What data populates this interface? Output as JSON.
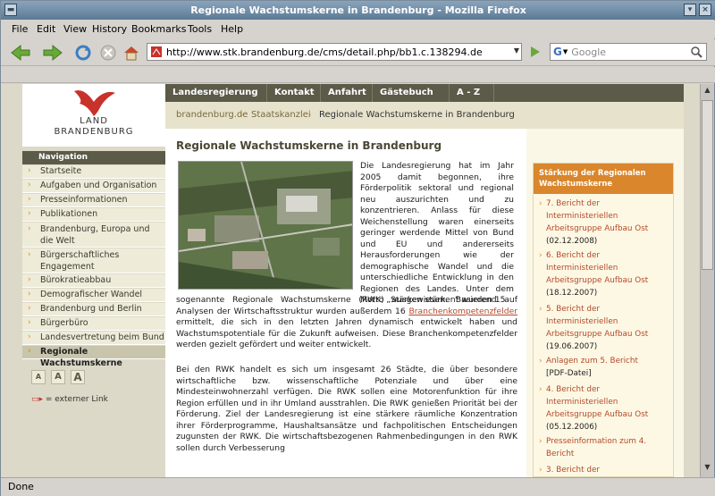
{
  "window": {
    "title": "Regionale Wachstumskerne in Brandenburg - Mozilla Firefox"
  },
  "menu": [
    "File",
    "Edit",
    "View",
    "History",
    "Bookmarks",
    "Tools",
    "Help"
  ],
  "toolbar": {
    "url": "http://www.stk.brandenburg.de/cms/detail.php/bb1.c.138294.de",
    "search_placeholder": "Google"
  },
  "status": "Done",
  "site": {
    "logo": {
      "line1": "LAND",
      "line2": "BRANDENBURG"
    },
    "topnav": [
      "Landesregierung",
      "Kontakt",
      "Anfahrt",
      "Gästebuch",
      "A - Z"
    ],
    "breadcrumb": [
      "brandenburg.de",
      "Staatskanzlei",
      "Regionale Wachstumskerne in Brandenburg"
    ],
    "nav_heading": "Navigation",
    "nav": [
      {
        "label": "Startseite"
      },
      {
        "label": "Aufgaben und Organisation"
      },
      {
        "label": "Presseinformationen"
      },
      {
        "label": "Publikationen"
      },
      {
        "label": "Brandenburg, Europa und die Welt"
      },
      {
        "label": "Bürgerschaftliches Engagement"
      },
      {
        "label": "Bürokratieabbau"
      },
      {
        "label": "Demografischer Wandel"
      },
      {
        "label": "Brandenburg und Berlin"
      },
      {
        "label": "Bürgerbüro"
      },
      {
        "label": "Landesvertretung beim Bund"
      },
      {
        "label": "Regionale Wachstumskerne"
      }
    ],
    "font_sizes": [
      "A",
      "A",
      "A"
    ],
    "external_link_note": "= externer Link",
    "heading": "Regionale Wachstumskerne in Brandenburg",
    "para1_side": "Die Landesregierung hat im Jahr 2005 damit begonnen, ihre Förderpolitik sektoral und regional neu auszurichten und zu konzentrieren. Anlass für diese Weichenstellung waren einerseits geringer werdende Mittel von Bund und EU und andererseits Herausforderungen wie der demographische Wandel und die unterschiedliche Entwicklung in den Regionen des Landes. Unter dem Motto „Stärken stärken“ wurden 15",
    "para1_full_a": "sogenannte Regionale Wachstumskerne (RWK) ausgewiesen. Basierend auf Analysen der Wirtschaftsstruktur wurden außerdem 16",
    "para1_link": "Branchenkompetenzfelder",
    "para1_full_b": "ermittelt, die sich in den letzten Jahren dynamisch entwickelt haben und Wachstumspotentiale für die Zukunft aufweisen. Diese Branchenkompetenzfelder werden gezielt gefördert und weiter entwickelt.",
    "para2": "Bei den RWK handelt es sich um insgesamt 26 Städte, die über besondere wirtschaftliche bzw. wissenschaftliche Potenziale und über eine Mindesteinwohnerzahl verfügen. Die RWK sollen eine Motorenfunktion für ihre Region erfüllen und in ihr Umland ausstrahlen. Die RWK genießen Priorität bei der Förderung. Ziel der Landesregierung ist eine stärkere räumliche Konzentration ihrer Förderprogramme, Haushaltsansätze und fachpolitischen Entscheidungen zugunsten der RWK. Die wirtschaftsbezogenen Rahmenbedingungen in den RWK sollen durch Verbesserung",
    "sidebar_heading": "Stärkung der Regionalen Wachstumskerne",
    "sidebar_items": [
      {
        "link": "7. Bericht der Interministeriellen Arbeitsgruppe Aufbau Ost",
        "date": "(02.12.2008)"
      },
      {
        "link": "6. Bericht der Interministeriellen Arbeitsgruppe Aufbau Ost",
        "date": "(18.12.2007)"
      },
      {
        "link": "5. Bericht der Interministeriellen Arbeitsgruppe Aufbau Ost",
        "date": "(19.06.2007)"
      },
      {
        "link": "Anlagen zum 5. Bericht",
        "date": "[PDF-Datei]"
      },
      {
        "link": "4. Bericht der Interministeriellen Arbeitsgruppe Aufbau Ost",
        "date": "(05.12.2006)"
      },
      {
        "link": "Presseinformation zum 4. Bericht",
        "date": ""
      },
      {
        "link": "3. Bericht der",
        "date": ""
      }
    ]
  }
}
